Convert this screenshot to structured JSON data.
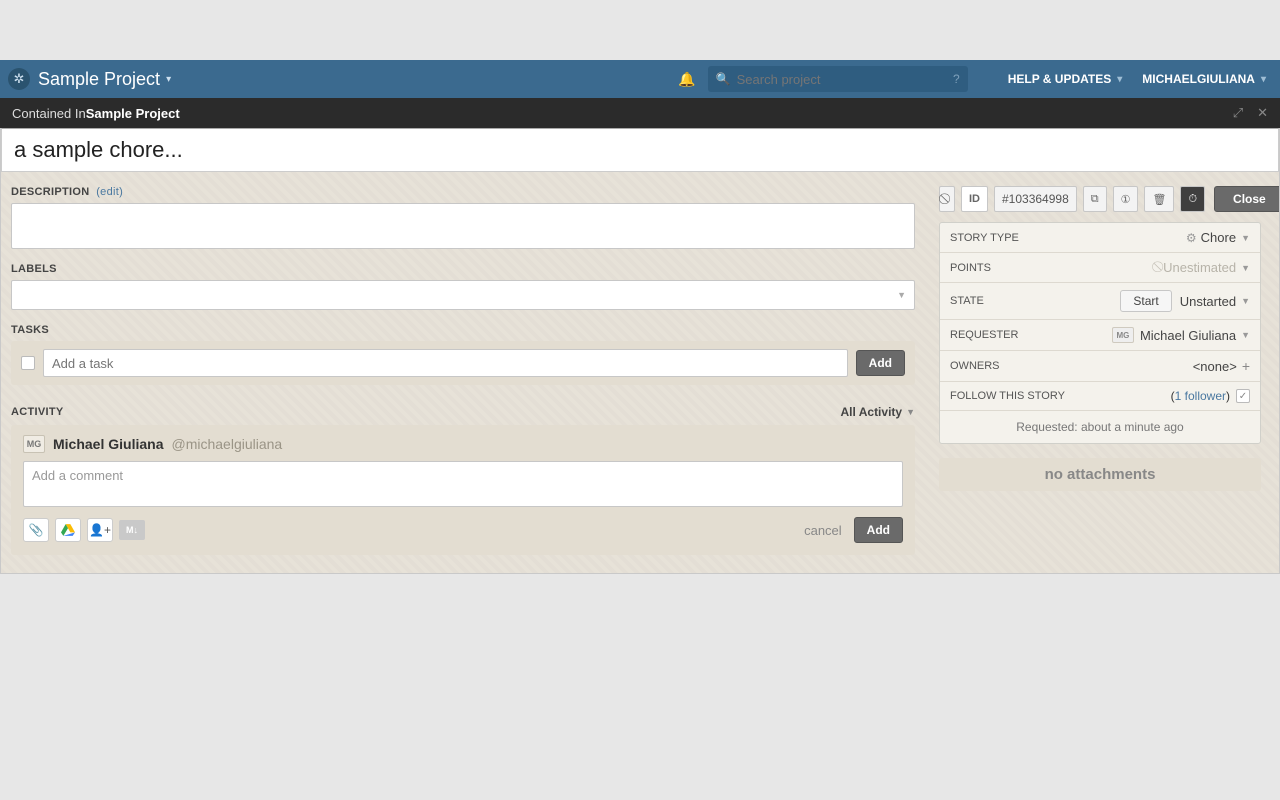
{
  "header": {
    "project_name": "Sample Project",
    "search_placeholder": "Search project",
    "help_label": "HELP & UPDATES",
    "user_label": "MICHAELGIULIANA"
  },
  "subheader": {
    "contained_label": "Contained In ",
    "project_name": "Sample Project"
  },
  "story": {
    "title": "a sample chore...",
    "description_label": "DESCRIPTION",
    "edit_label": "(edit)",
    "labels_label": "LABELS",
    "tasks_label": "TASKS",
    "task_placeholder": "Add a task",
    "task_add_button": "Add"
  },
  "activity": {
    "section_label": "ACTIVITY",
    "filter_label": "All Activity",
    "user_initials": "MG",
    "user_name": "Michael Giuliana",
    "user_handle": "@michaelgiuliana",
    "comment_placeholder": "Add a comment",
    "markdown_badge": "M↓",
    "cancel_label": "cancel",
    "add_label": "Add"
  },
  "side": {
    "id_prefix": "ID",
    "id_value": "#103364998",
    "close_label": "Close",
    "rows": {
      "story_type_label": "STORY TYPE",
      "story_type_value": "Chore",
      "points_label": "POINTS",
      "points_value": "Unestimated",
      "state_label": "STATE",
      "start_button": "Start",
      "state_value": "Unstarted",
      "requester_label": "REQUESTER",
      "requester_initials": "MG",
      "requester_value": "Michael Giuliana",
      "owners_label": "OWNERS",
      "owners_value": "<none>",
      "follow_label": "FOLLOW THIS STORY",
      "follow_count_prefix": "(",
      "follow_link_text": "1 follower",
      "follow_count_suffix": ")"
    },
    "requested_text": "Requested: about a minute ago",
    "no_attachments": "no attachments"
  }
}
